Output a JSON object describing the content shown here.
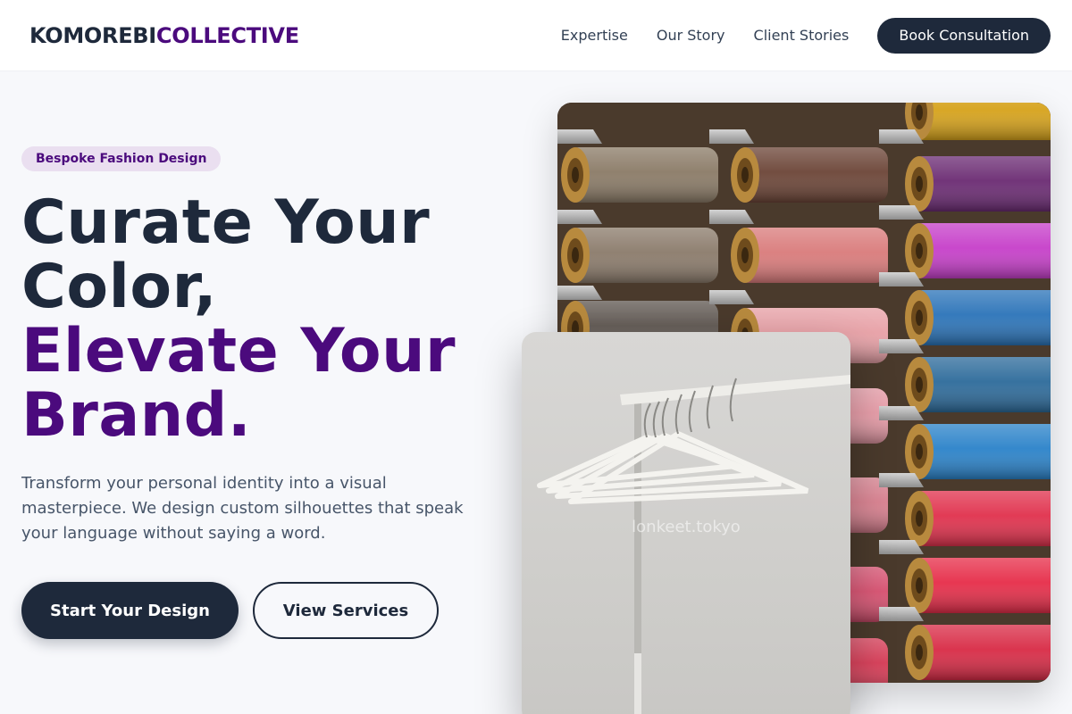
{
  "header": {
    "logo_part1": "KOMOREBI",
    "logo_part2": "COLLECTIVE",
    "nav": [
      "Expertise",
      "Our Story",
      "Client Stories"
    ],
    "cta": "Book Consultation"
  },
  "hero": {
    "badge": "Bespoke Fashion Design",
    "headline_line1": "Curate Your",
    "headline_line2": "Color,",
    "headline_line3": "Elevate Your",
    "headline_line4": "Brand.",
    "subtext": "Transform your personal identity into a visual masterpiece. We design custom silhouettes that speak your language without saying a word.",
    "primary_button": "Start Your Design",
    "secondary_button": "View Services"
  },
  "images": {
    "spools_image": "thread-spools-photo",
    "hangers_image": "clothing-rack-hangers-photo",
    "watermark": "lonkeet.tokyo"
  },
  "colors": {
    "brand_dark": "#1e293b",
    "brand_purple": "#4b0a7d",
    "badge_bg": "#eadff0"
  }
}
